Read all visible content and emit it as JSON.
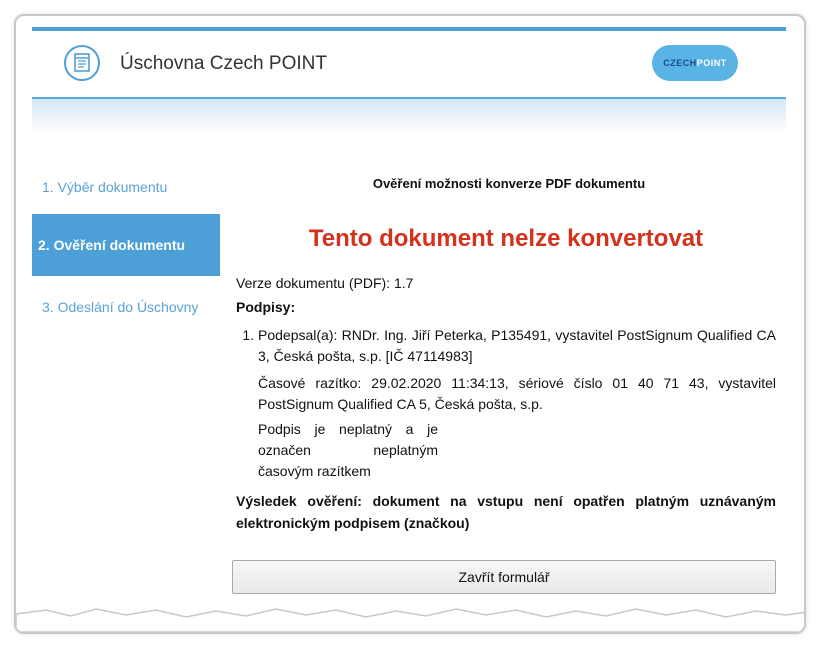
{
  "header": {
    "title": "Úschovna Czech POINT",
    "logo_left": "CZECH",
    "logo_right": "POINT"
  },
  "nav": {
    "items": [
      {
        "label": "1. Výběr dokumentu"
      },
      {
        "label": "2. Ověření dokumentu"
      },
      {
        "label": "3. Odeslání do Úschovny"
      }
    ]
  },
  "main": {
    "heading": "Ověření možnosti konverze PDF dokumentu",
    "error": "Tento dokument nelze konvertovat",
    "version": "Verze dokumentu (PDF): 1.7",
    "signatures_label": "Podpisy:",
    "signature": {
      "signed_by": "Podepsal(a): RNDr. Ing. Jiří Peterka, P135491, vystavitel PostSignum Qualified CA 3, Česká pošta, s.p. [IČ 47114983]",
      "timestamp": "Časové razítko: 29.02.2020 11:34:13, sériové číslo 01 40 71 43, vystavitel PostSignum Qualified CA 5, Česká pošta, s.p.",
      "status": "Podpis je neplatný a je označen neplatným časovým razítkem"
    },
    "result": "Výsledek ověření:  dokument na vstupu není opatřen platným uznávaným elektronickým podpisem (značkou)",
    "close_button": "Zavřít formulář"
  },
  "colors": {
    "accent": "#4d9fd8",
    "error": "#d3321d"
  }
}
